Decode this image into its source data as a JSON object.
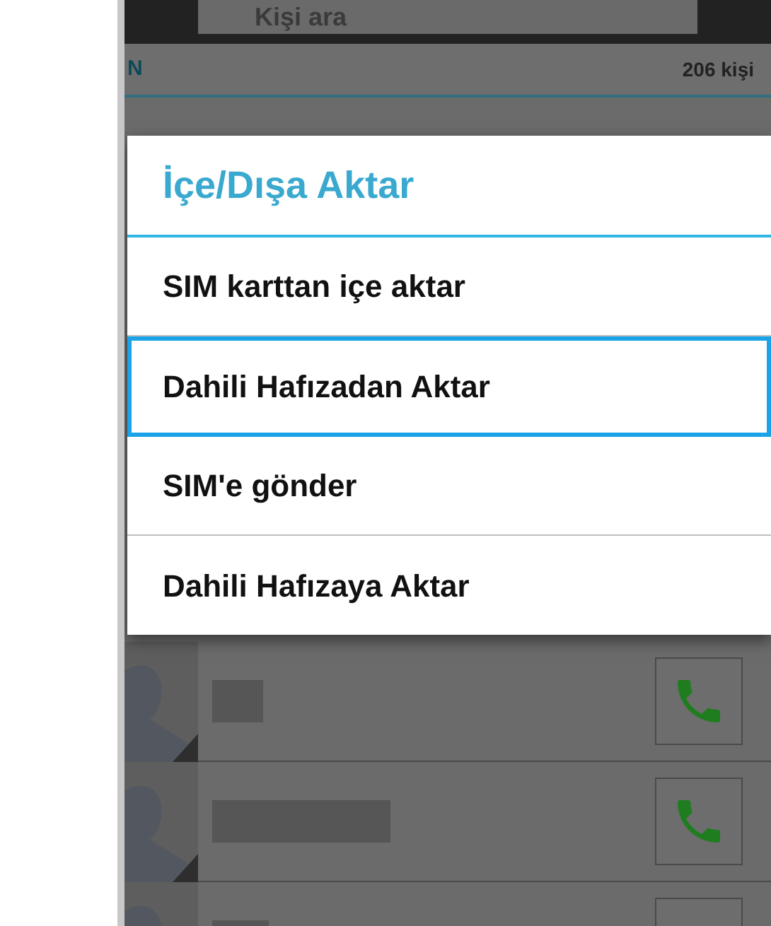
{
  "search": {
    "placeholder": "Kişi ara"
  },
  "header": {
    "letter": "N",
    "count": "206 kişi"
  },
  "dialog": {
    "title": "İçe/Dışa Aktar",
    "items": [
      {
        "label": "SIM karttan içe aktar",
        "selected": false
      },
      {
        "label": "Dahili Hafızadan Aktar",
        "selected": true
      },
      {
        "label": "SIM'e gönder",
        "selected": false
      },
      {
        "label": "Dahili Hafızaya Aktar",
        "selected": false
      }
    ]
  }
}
